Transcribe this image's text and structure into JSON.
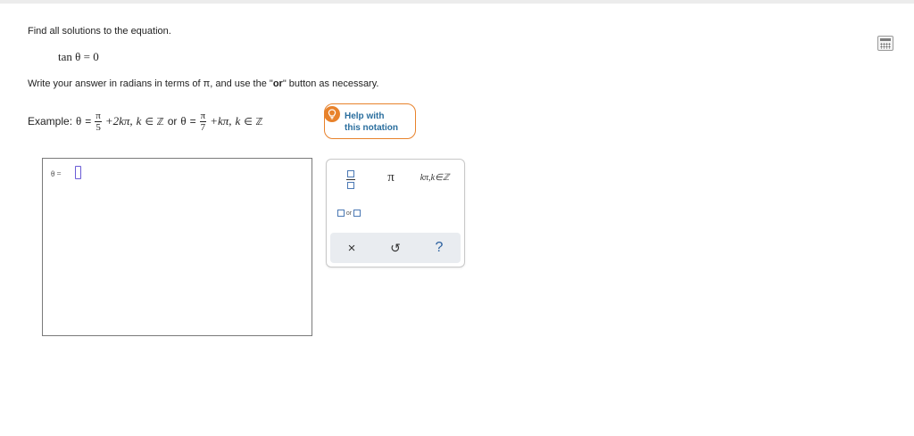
{
  "question": {
    "prompt": "Find all solutions to the equation.",
    "equation": "tan θ = 0",
    "instructions_before": "Write your answer in radians in terms of π, and use the \"",
    "instructions_bold": "or",
    "instructions_after": "\" button as necessary."
  },
  "example": {
    "label": "Example:",
    "theta": "θ",
    "equals": "=",
    "frac1_num": "π",
    "frac1_den": "5",
    "term1": "+2kπ,",
    "k_var": "k",
    "in_z": "∈ ℤ",
    "or_text": "or",
    "frac2_num": "π",
    "frac2_den": "7",
    "term2": "+kπ,"
  },
  "help_button": {
    "line1": "Help with",
    "line2": "this notation",
    "icon": "lightbulb-icon"
  },
  "answer": {
    "label": "θ ="
  },
  "keypad": {
    "keys": {
      "fraction": "fraction-icon",
      "pi": "π",
      "k_pi": "kπ,k∈ℤ",
      "or": "or"
    },
    "actions": {
      "clear": "×",
      "undo": "↺",
      "help": "?"
    }
  },
  "toolbar": {
    "calculator_icon": "calculator-icon"
  }
}
